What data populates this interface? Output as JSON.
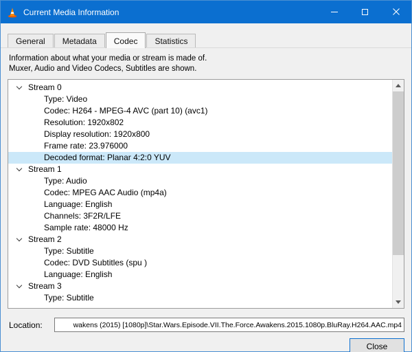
{
  "window": {
    "title": "Current Media Information"
  },
  "tabs": [
    {
      "label": "General",
      "active": false
    },
    {
      "label": "Metadata",
      "active": false
    },
    {
      "label": "Codec",
      "active": true
    },
    {
      "label": "Statistics",
      "active": false
    }
  ],
  "description": {
    "line1": "Information about what your media or stream is made of.",
    "line2": "Muxer, Audio and Video Codecs, Subtitles are shown."
  },
  "tree": {
    "selected_item": "Decoded format: Planar 4:2:0 YUV",
    "streams": [
      {
        "label": "Stream 0",
        "items": [
          "Type: Video",
          "Codec: H264 - MPEG-4 AVC (part 10) (avc1)",
          "Resolution: 1920x802",
          "Display resolution: 1920x800",
          "Frame rate: 23.976000",
          "Decoded format: Planar 4:2:0 YUV"
        ]
      },
      {
        "label": "Stream 1",
        "items": [
          "Type: Audio",
          "Codec: MPEG AAC Audio (mp4a)",
          "Language: English",
          "Channels: 3F2R/LFE",
          "Sample rate: 48000 Hz"
        ]
      },
      {
        "label": "Stream 2",
        "items": [
          "Type: Subtitle",
          "Codec: DVD Subtitles (spu )",
          "Language: English"
        ]
      },
      {
        "label": "Stream 3",
        "items": [
          "Type: Subtitle"
        ]
      }
    ]
  },
  "location": {
    "label": "Location:",
    "value": "wakens (2015) [1080p]\\Star.Wars.Episode.VII.The.Force.Awakens.2015.1080p.BluRay.H264.AAC.mp4"
  },
  "buttons": {
    "close": "Close"
  },
  "colors": {
    "titlebar": "#0b6fd0",
    "selection": "#cbe8f9"
  }
}
